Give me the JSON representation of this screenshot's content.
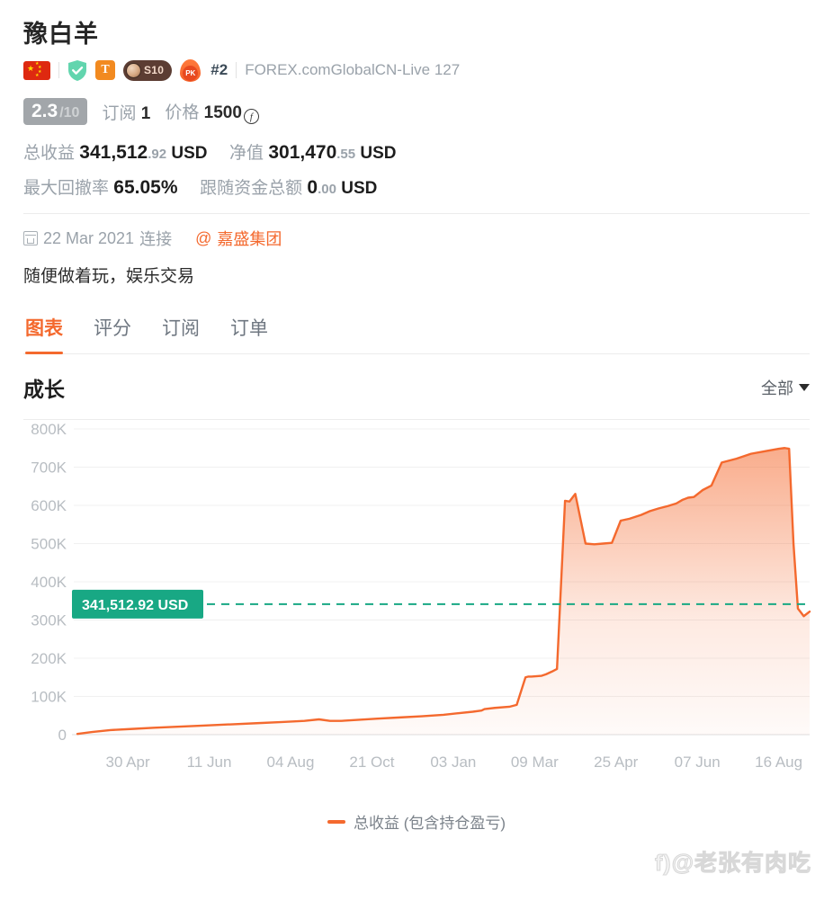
{
  "profile": {
    "name": "豫白羊",
    "flag_icon": "flag-cn-icon",
    "verified_icon": "shield-check-icon",
    "t_badge": "T",
    "level_badge": "S10",
    "pk_badge": "PK",
    "rank": "#2",
    "broker_account": "FOREX.comGlobalCN-Live 127",
    "score": "2.3",
    "score_denominator": "/10",
    "subscribers_label": "订阅",
    "subscribers_value": "1",
    "price_label": "价格",
    "price_value": "1500",
    "price_currency_icon": "f-coin-icon"
  },
  "stats": {
    "total_profit_label": "总收益",
    "total_profit_value": "341,512",
    "total_profit_cents": ".92",
    "total_profit_currency": "USD",
    "equity_label": "净值",
    "equity_value": "301,470",
    "equity_cents": ".55",
    "equity_currency": "USD",
    "drawdown_label": "最大回撤率",
    "drawdown_value": "65.05%",
    "follow_funds_label": "跟随资金总额",
    "follow_funds_value": "0",
    "follow_funds_cents": ".00",
    "follow_funds_currency": "USD"
  },
  "meta": {
    "calendar_icon": "calendar-icon",
    "date": "22 Mar 2021",
    "connect_label": "连接",
    "at_symbol": "@",
    "broker_name": "嘉盛集团",
    "description": "随便做着玩，娱乐交易"
  },
  "tabs": [
    {
      "label": "图表",
      "active": true
    },
    {
      "label": "评分",
      "active": false
    },
    {
      "label": "订阅",
      "active": false
    },
    {
      "label": "订单",
      "active": false
    }
  ],
  "chart_section": {
    "title": "成长",
    "range_selected": "全部",
    "dropdown_icon": "chevron-down-icon",
    "marker_label": "341,512.92 USD",
    "legend_label": "总收益 (包含持仓盈亏)"
  },
  "watermark": "f)@老张有肉吃",
  "colors": {
    "accent_orange": "#f4692e",
    "marker_green": "#18a884",
    "muted_gray": "#9aa2aa",
    "score_chip": "#a2a6aa"
  },
  "chart_data": {
    "type": "area",
    "title": "成长",
    "xlabel": "",
    "ylabel": "",
    "ylim": [
      0,
      800000
    ],
    "grid": true,
    "legend_position": "bottom",
    "ytick_labels": [
      "0",
      "100K",
      "200K",
      "300K",
      "400K",
      "500K",
      "600K",
      "700K",
      "800K"
    ],
    "ytick_values": [
      0,
      100000,
      200000,
      300000,
      400000,
      500000,
      600000,
      700000,
      800000
    ],
    "xtick_labels": [
      "30 Apr",
      "11 Jun",
      "04 Aug",
      "21 Oct",
      "03 Jan",
      "09 Mar",
      "25 Apr",
      "07 Jun",
      "16 Aug"
    ],
    "reference_line": {
      "value": 341512.92,
      "label": "341,512.92 USD",
      "color": "#18a884",
      "style": "dashed"
    },
    "series": [
      {
        "name": "总收益 (包含持仓盈亏)",
        "color": "#f4692e",
        "x": [
          0.0,
          0.02,
          0.045,
          0.075,
          0.105,
          0.14,
          0.175,
          0.21,
          0.245,
          0.28,
          0.31,
          0.33,
          0.345,
          0.36,
          0.385,
          0.41,
          0.44,
          0.47,
          0.5,
          0.52,
          0.54,
          0.552,
          0.556,
          0.57,
          0.59,
          0.6,
          0.612,
          0.616,
          0.62,
          0.634,
          0.64,
          0.648,
          0.655,
          0.666,
          0.672,
          0.68,
          0.694,
          0.706,
          0.718,
          0.73,
          0.742,
          0.754,
          0.762,
          0.77,
          0.782,
          0.794,
          0.806,
          0.818,
          0.826,
          0.834,
          0.842,
          0.854,
          0.866,
          0.88,
          0.9,
          0.92,
          0.94,
          0.958,
          0.966,
          0.972,
          0.978,
          0.984,
          0.992,
          1.0
        ],
        "y": [
          2000,
          7000,
          12000,
          15000,
          18000,
          21000,
          24000,
          27000,
          30000,
          33000,
          36000,
          40000,
          36000,
          36000,
          39000,
          42000,
          45000,
          48000,
          52000,
          56000,
          60000,
          63000,
          67000,
          70000,
          73000,
          78000,
          150000,
          152000,
          152000,
          154000,
          158000,
          165000,
          172000,
          612000,
          610000,
          630000,
          500000,
          498000,
          500000,
          502000,
          560000,
          565000,
          570000,
          575000,
          585000,
          592000,
          598000,
          605000,
          614000,
          620000,
          622000,
          640000,
          652000,
          712000,
          722000,
          735000,
          742000,
          748000,
          750000,
          748000,
          500000,
          330000,
          310000,
          322000
        ]
      }
    ]
  }
}
